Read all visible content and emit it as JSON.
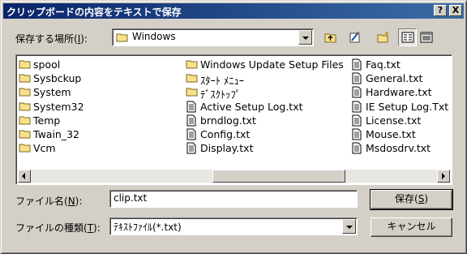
{
  "window": {
    "title": "クリップボードの内容をテキストで保存",
    "help_button": "?",
    "close_button": "X"
  },
  "location": {
    "label": "保存する場所(",
    "label_key": "I",
    "label_end": "):",
    "value": "Windows"
  },
  "toolbar": {
    "up_folder": "up-one-level",
    "favorites": "favorites",
    "new_folder": "create-new-folder",
    "list_view": "list-view",
    "details_view": "details-view"
  },
  "files": {
    "col1": [
      {
        "name": "spool",
        "icon": "folder-icon"
      },
      {
        "name": "Sysbckup",
        "icon": "folder-icon"
      },
      {
        "name": "System",
        "icon": "folder-icon"
      },
      {
        "name": "System32",
        "icon": "folder-icon"
      },
      {
        "name": "Temp",
        "icon": "folder-icon"
      },
      {
        "name": "Twain_32",
        "icon": "folder-icon"
      },
      {
        "name": "Vcm",
        "icon": "folder-icon"
      }
    ],
    "col2": [
      {
        "name": "Windows Update Setup Files",
        "icon": "folder-icon"
      },
      {
        "name": "ｽﾀｰﾄ ﾒﾆｭｰ",
        "icon": "folder-icon"
      },
      {
        "name": "ﾃﾞｽｸﾄｯﾌﾟ",
        "icon": "folder-icon"
      },
      {
        "name": "Active Setup Log.txt",
        "icon": "text-file-icon"
      },
      {
        "name": "brndlog.txt",
        "icon": "text-file-icon"
      },
      {
        "name": "Config.txt",
        "icon": "text-file-icon"
      },
      {
        "name": "Display.txt",
        "icon": "text-file-icon"
      }
    ],
    "col3": [
      {
        "name": "Faq.txt",
        "icon": "text-file-icon"
      },
      {
        "name": "General.txt",
        "icon": "text-file-icon"
      },
      {
        "name": "Hardware.txt",
        "icon": "text-file-icon"
      },
      {
        "name": "IE Setup Log.Txt",
        "icon": "text-file-icon"
      },
      {
        "name": "License.txt",
        "icon": "text-file-icon"
      },
      {
        "name": "Mouse.txt",
        "icon": "text-file-icon"
      },
      {
        "name": "Msdosdrv.txt",
        "icon": "text-file-icon"
      }
    ]
  },
  "filename": {
    "label": "ファイル名(",
    "label_key": "N",
    "label_end": "):",
    "value": "clip.txt"
  },
  "filetype": {
    "label": "ファイルの種類(",
    "label_key": "T",
    "label_end": "):",
    "value": "ﾃｷｽﾄﾌｧｲﾙ(*.txt)"
  },
  "buttons": {
    "save": "保存(",
    "save_key": "S",
    "save_end": ")",
    "cancel": "キャンセル"
  }
}
